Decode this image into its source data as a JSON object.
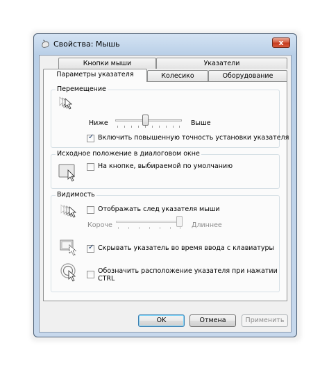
{
  "window": {
    "title": "Свойства: Мышь",
    "close_glyph": "x",
    "accent": "#c43a1e"
  },
  "tabs": {
    "row1": [
      "Кнопки мыши",
      "Указатели"
    ],
    "row2": [
      "Параметры указателя",
      "Колесико",
      "Оборудование"
    ],
    "active": "Параметры указателя"
  },
  "motion": {
    "title": "Перемещение",
    "slow_label": "Ниже",
    "fast_label": "Выше",
    "speed_level": 0.45,
    "precision_label": "Включить повышенную точность установки указателя",
    "precision_checked": true,
    "icon": "pointer-speed-icon"
  },
  "snap": {
    "title": "Исходное положение в диалоговом окне",
    "snap_label": "На кнопке, выбираемой по умолчанию",
    "snap_checked": false,
    "icon": "snap-to-button-icon"
  },
  "visibility": {
    "title": "Видимость",
    "trails_label": "Отображать след указателя мыши",
    "trails_checked": false,
    "short_label": "Короче",
    "long_label": "Длиннее",
    "trail_level": 1.0,
    "hide_label": "Скрывать указатель во время ввода с клавиатуры",
    "hide_checked": true,
    "ctrl_label_line1": "Обозначить расположение указателя при нажатии",
    "ctrl_label_line2": "CTRL",
    "ctrl_checked": false,
    "icons": [
      "pointer-trails-icon",
      "hide-pointer-icon",
      "ctrl-locate-icon"
    ]
  },
  "buttons": {
    "ok": "OK",
    "cancel": "Отмена",
    "apply": "Применить"
  },
  "check_glyph": "✓"
}
